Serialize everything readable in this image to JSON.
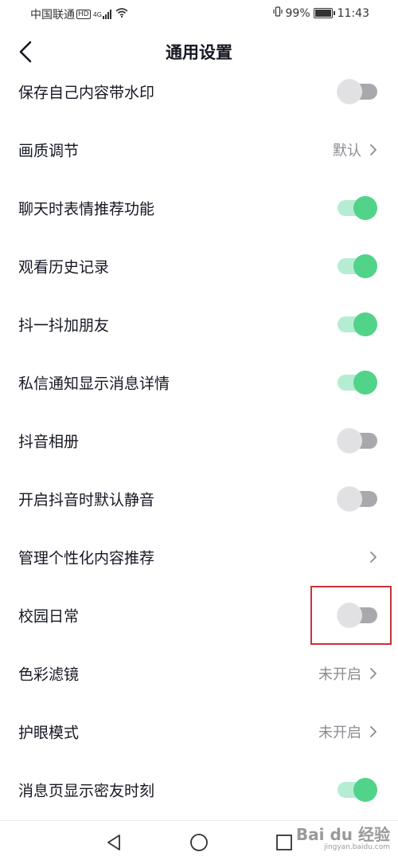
{
  "status_bar": {
    "carrier": "中国联通",
    "hd_badge": "HD",
    "network": "4G",
    "battery_percent": "99%",
    "time": "11:43"
  },
  "header": {
    "title": "通用设置",
    "back_icon": "chevron-left-icon"
  },
  "rows": [
    {
      "label": "保存自己内容带水印",
      "type": "toggle",
      "on": false
    },
    {
      "label": "画质调节",
      "type": "link",
      "value": "默认"
    },
    {
      "label": "聊天时表情推荐功能",
      "type": "toggle",
      "on": true
    },
    {
      "label": "观看历史记录",
      "type": "toggle",
      "on": true
    },
    {
      "label": "抖一抖加朋友",
      "type": "toggle",
      "on": true
    },
    {
      "label": "私信通知显示消息详情",
      "type": "toggle",
      "on": true
    },
    {
      "label": "抖音相册",
      "type": "toggle",
      "on": false
    },
    {
      "label": "开启抖音时默认静音",
      "type": "toggle",
      "on": false
    },
    {
      "label": "管理个性化内容推荐",
      "type": "link",
      "value": ""
    },
    {
      "label": "校园日常",
      "type": "toggle",
      "on": false,
      "highlighted": true
    },
    {
      "label": "色彩滤镜",
      "type": "link",
      "value": "未开启"
    },
    {
      "label": "护眼模式",
      "type": "link",
      "value": "未开启"
    },
    {
      "label": "消息页显示密友时刻",
      "type": "toggle",
      "on": true
    }
  ],
  "colors": {
    "toggle_on_knob": "#52d38a",
    "toggle_on_track": "#b5edd2",
    "toggle_off_knob": "#e1e1e3",
    "toggle_off_track": "#a9a9ad",
    "highlight_border": "#c8323a"
  },
  "nav_bar": {
    "icons": [
      "back-triangle-icon",
      "home-circle-icon",
      "recents-square-icon"
    ]
  },
  "watermark": {
    "main": "Bai du 经验",
    "sub": "jingyan.baidu.com"
  }
}
